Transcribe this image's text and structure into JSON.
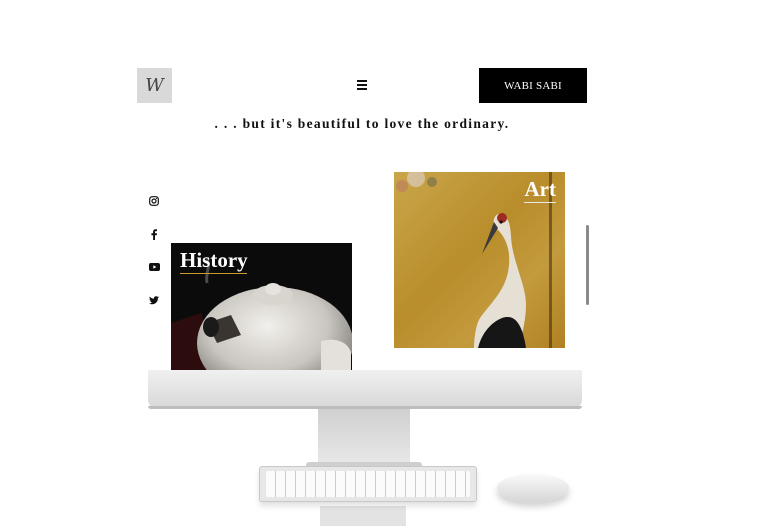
{
  "header": {
    "logo_text": "W",
    "brand_button": "WABI SABI"
  },
  "tagline": ". . . but it's beautiful to love the ordinary.",
  "social": {
    "items": [
      "instagram-icon",
      "facebook-icon",
      "youtube-icon",
      "twitter-icon"
    ]
  },
  "cards": {
    "history": {
      "title": "History"
    },
    "art": {
      "title": "Art"
    }
  },
  "colors": {
    "brand_button_bg": "#000000",
    "logo_bg": "#d9d9d9",
    "art_bg": "#c39a3d"
  }
}
